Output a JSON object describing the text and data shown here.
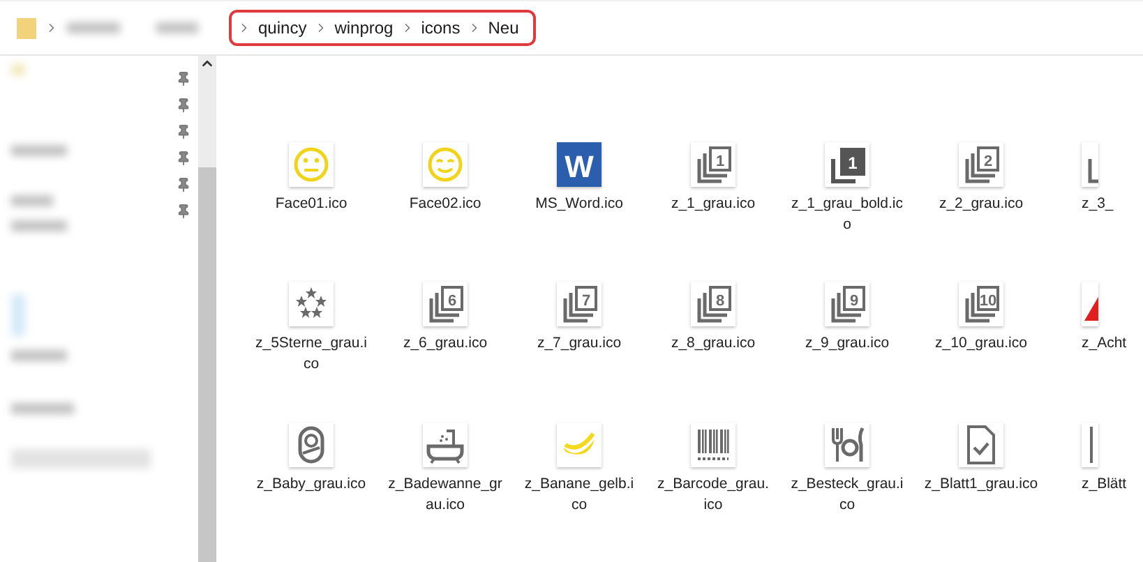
{
  "address_bar": {
    "highlighted": true,
    "crumbs": [
      {
        "label": "quincy"
      },
      {
        "label": "winprog"
      },
      {
        "label": "icons"
      },
      {
        "label": "Neu"
      }
    ]
  },
  "rows": [
    [
      {
        "label": "Face01.ico",
        "kind": "full"
      },
      {
        "label": "Face02.ico",
        "kind": "full"
      },
      {
        "label": "MS_Word.ico",
        "icon_text": "W",
        "kind": "full"
      },
      {
        "label": "z_1_grau.ico",
        "icon_text": "1",
        "kind": "full"
      },
      {
        "label": "z_1_grau_bold.ico",
        "icon_text": "1",
        "kind": "full"
      },
      {
        "label": "z_2_grau.ico",
        "icon_text": "2",
        "kind": "full"
      },
      {
        "label": "z_3_",
        "kind": "partial"
      }
    ],
    [
      {
        "label": "z_5Sterne_grau.ico",
        "kind": "full"
      },
      {
        "label": "z_6_grau.ico",
        "icon_text": "6",
        "kind": "full"
      },
      {
        "label": "z_7_grau.ico",
        "icon_text": "7",
        "kind": "full"
      },
      {
        "label": "z_8_grau.ico",
        "icon_text": "8",
        "kind": "full"
      },
      {
        "label": "z_9_grau.ico",
        "icon_text": "9",
        "kind": "full"
      },
      {
        "label": "z_10_grau.ico",
        "icon_text": "10",
        "kind": "full"
      },
      {
        "label": "z_Acht",
        "kind": "partial"
      }
    ],
    [
      {
        "label": "z_Baby_grau.ico",
        "kind": "full"
      },
      {
        "label": "z_Badewanne_grau.ico",
        "kind": "full"
      },
      {
        "label": "z_Banane_gelb.ico",
        "kind": "full"
      },
      {
        "label": "z_Barcode_grau.ico",
        "kind": "full"
      },
      {
        "label": "z_Besteck_grau.ico",
        "kind": "full"
      },
      {
        "label": "z_Blatt1_grau.ico",
        "kind": "full"
      },
      {
        "label": "z_Blätt",
        "kind": "partial"
      }
    ]
  ]
}
